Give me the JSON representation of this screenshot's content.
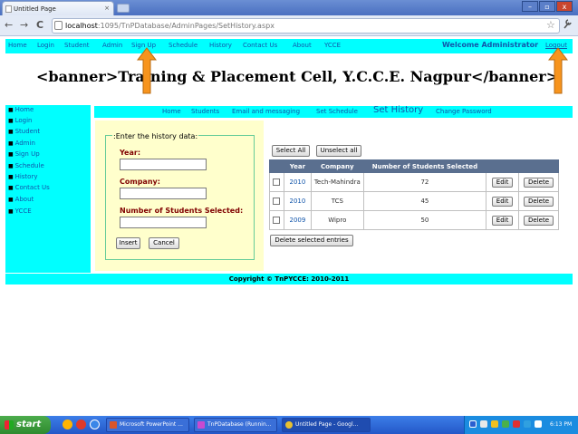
{
  "browser": {
    "tab_title": "Untitled Page",
    "tab_close": "×",
    "new_tab": "+",
    "address_host": "localhost",
    "address_path": ":1095/TnPDatabase/AdminPages/SetHistory.aspx",
    "back": "←",
    "forward": "→",
    "reload": "C",
    "star": "☆",
    "wrench": "🔧",
    "minimize": "–",
    "maximize": "▫",
    "close": "x"
  },
  "topnav": {
    "links": [
      "Home",
      "Login",
      "Student",
      "Admin",
      "Sign Up",
      "Schedule",
      "History",
      "Contact Us",
      "About",
      "YCCE"
    ],
    "welcome": "Welcome Administrator",
    "logout": "Logout"
  },
  "banner": "<banner>Training & Placement Cell, Y.C.C.E. Nagpur</banner>",
  "sidebar": {
    "items": [
      "Home",
      "Login",
      "Student",
      "Admin",
      "Sign Up",
      "Schedule",
      "History",
      "Contact Us",
      "About",
      "YCCE"
    ]
  },
  "subnav": {
    "links": [
      "Home",
      "Students",
      "Email and messaging",
      "Set Schedule"
    ],
    "active": "Set History",
    "last": "Change Password"
  },
  "form": {
    "legend": ":Enter the history data:",
    "year_label": "Year:",
    "company_label": "Company:",
    "count_label": "Number of Students Selected:",
    "insert": "Insert",
    "cancel": "Cancel"
  },
  "table": {
    "select_all": "Select All",
    "unselect_all": "Unselect all",
    "headers": [
      "",
      "Year",
      "Company",
      "Number of Students Selected",
      "",
      ""
    ],
    "rows": [
      {
        "year": "2010",
        "company": "Tech-Mahindra",
        "count": "72"
      },
      {
        "year": "2010",
        "company": "TCS",
        "count": "45"
      },
      {
        "year": "2009",
        "company": "Wipro",
        "count": "50"
      }
    ],
    "edit": "Edit",
    "delete": "Delete",
    "delete_selected": "Delete selected entries"
  },
  "footer": {
    "copyright": "Copyright © TnPYCCE: 2010-2011"
  },
  "taskbar": {
    "start": "start",
    "tasks": [
      "Microsoft PowerPoint ...",
      "TnPDatabase (Runnin...",
      "Untitled Page - Googl..."
    ],
    "clock": "6:13 PM"
  },
  "colors": {
    "cyan": "#00ffff",
    "arrow": "#f7941d",
    "link": "#1155aa",
    "label": "#800000"
  }
}
